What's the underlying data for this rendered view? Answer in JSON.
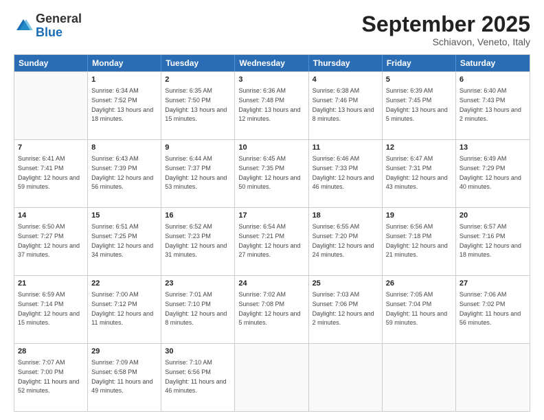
{
  "header": {
    "logo_general": "General",
    "logo_blue": "Blue",
    "month_title": "September 2025",
    "location": "Schiavon, Veneto, Italy"
  },
  "days_of_week": [
    "Sunday",
    "Monday",
    "Tuesday",
    "Wednesday",
    "Thursday",
    "Friday",
    "Saturday"
  ],
  "weeks": [
    [
      {
        "day": "",
        "sunrise": "",
        "sunset": "",
        "daylight": ""
      },
      {
        "day": "1",
        "sunrise": "Sunrise: 6:34 AM",
        "sunset": "Sunset: 7:52 PM",
        "daylight": "Daylight: 13 hours and 18 minutes."
      },
      {
        "day": "2",
        "sunrise": "Sunrise: 6:35 AM",
        "sunset": "Sunset: 7:50 PM",
        "daylight": "Daylight: 13 hours and 15 minutes."
      },
      {
        "day": "3",
        "sunrise": "Sunrise: 6:36 AM",
        "sunset": "Sunset: 7:48 PM",
        "daylight": "Daylight: 13 hours and 12 minutes."
      },
      {
        "day": "4",
        "sunrise": "Sunrise: 6:38 AM",
        "sunset": "Sunset: 7:46 PM",
        "daylight": "Daylight: 13 hours and 8 minutes."
      },
      {
        "day": "5",
        "sunrise": "Sunrise: 6:39 AM",
        "sunset": "Sunset: 7:45 PM",
        "daylight": "Daylight: 13 hours and 5 minutes."
      },
      {
        "day": "6",
        "sunrise": "Sunrise: 6:40 AM",
        "sunset": "Sunset: 7:43 PM",
        "daylight": "Daylight: 13 hours and 2 minutes."
      }
    ],
    [
      {
        "day": "7",
        "sunrise": "Sunrise: 6:41 AM",
        "sunset": "Sunset: 7:41 PM",
        "daylight": "Daylight: 12 hours and 59 minutes."
      },
      {
        "day": "8",
        "sunrise": "Sunrise: 6:43 AM",
        "sunset": "Sunset: 7:39 PM",
        "daylight": "Daylight: 12 hours and 56 minutes."
      },
      {
        "day": "9",
        "sunrise": "Sunrise: 6:44 AM",
        "sunset": "Sunset: 7:37 PM",
        "daylight": "Daylight: 12 hours and 53 minutes."
      },
      {
        "day": "10",
        "sunrise": "Sunrise: 6:45 AM",
        "sunset": "Sunset: 7:35 PM",
        "daylight": "Daylight: 12 hours and 50 minutes."
      },
      {
        "day": "11",
        "sunrise": "Sunrise: 6:46 AM",
        "sunset": "Sunset: 7:33 PM",
        "daylight": "Daylight: 12 hours and 46 minutes."
      },
      {
        "day": "12",
        "sunrise": "Sunrise: 6:47 AM",
        "sunset": "Sunset: 7:31 PM",
        "daylight": "Daylight: 12 hours and 43 minutes."
      },
      {
        "day": "13",
        "sunrise": "Sunrise: 6:49 AM",
        "sunset": "Sunset: 7:29 PM",
        "daylight": "Daylight: 12 hours and 40 minutes."
      }
    ],
    [
      {
        "day": "14",
        "sunrise": "Sunrise: 6:50 AM",
        "sunset": "Sunset: 7:27 PM",
        "daylight": "Daylight: 12 hours and 37 minutes."
      },
      {
        "day": "15",
        "sunrise": "Sunrise: 6:51 AM",
        "sunset": "Sunset: 7:25 PM",
        "daylight": "Daylight: 12 hours and 34 minutes."
      },
      {
        "day": "16",
        "sunrise": "Sunrise: 6:52 AM",
        "sunset": "Sunset: 7:23 PM",
        "daylight": "Daylight: 12 hours and 31 minutes."
      },
      {
        "day": "17",
        "sunrise": "Sunrise: 6:54 AM",
        "sunset": "Sunset: 7:21 PM",
        "daylight": "Daylight: 12 hours and 27 minutes."
      },
      {
        "day": "18",
        "sunrise": "Sunrise: 6:55 AM",
        "sunset": "Sunset: 7:20 PM",
        "daylight": "Daylight: 12 hours and 24 minutes."
      },
      {
        "day": "19",
        "sunrise": "Sunrise: 6:56 AM",
        "sunset": "Sunset: 7:18 PM",
        "daylight": "Daylight: 12 hours and 21 minutes."
      },
      {
        "day": "20",
        "sunrise": "Sunrise: 6:57 AM",
        "sunset": "Sunset: 7:16 PM",
        "daylight": "Daylight: 12 hours and 18 minutes."
      }
    ],
    [
      {
        "day": "21",
        "sunrise": "Sunrise: 6:59 AM",
        "sunset": "Sunset: 7:14 PM",
        "daylight": "Daylight: 12 hours and 15 minutes."
      },
      {
        "day": "22",
        "sunrise": "Sunrise: 7:00 AM",
        "sunset": "Sunset: 7:12 PM",
        "daylight": "Daylight: 12 hours and 11 minutes."
      },
      {
        "day": "23",
        "sunrise": "Sunrise: 7:01 AM",
        "sunset": "Sunset: 7:10 PM",
        "daylight": "Daylight: 12 hours and 8 minutes."
      },
      {
        "day": "24",
        "sunrise": "Sunrise: 7:02 AM",
        "sunset": "Sunset: 7:08 PM",
        "daylight": "Daylight: 12 hours and 5 minutes."
      },
      {
        "day": "25",
        "sunrise": "Sunrise: 7:03 AM",
        "sunset": "Sunset: 7:06 PM",
        "daylight": "Daylight: 12 hours and 2 minutes."
      },
      {
        "day": "26",
        "sunrise": "Sunrise: 7:05 AM",
        "sunset": "Sunset: 7:04 PM",
        "daylight": "Daylight: 11 hours and 59 minutes."
      },
      {
        "day": "27",
        "sunrise": "Sunrise: 7:06 AM",
        "sunset": "Sunset: 7:02 PM",
        "daylight": "Daylight: 11 hours and 56 minutes."
      }
    ],
    [
      {
        "day": "28",
        "sunrise": "Sunrise: 7:07 AM",
        "sunset": "Sunset: 7:00 PM",
        "daylight": "Daylight: 11 hours and 52 minutes."
      },
      {
        "day": "29",
        "sunrise": "Sunrise: 7:09 AM",
        "sunset": "Sunset: 6:58 PM",
        "daylight": "Daylight: 11 hours and 49 minutes."
      },
      {
        "day": "30",
        "sunrise": "Sunrise: 7:10 AM",
        "sunset": "Sunset: 6:56 PM",
        "daylight": "Daylight: 11 hours and 46 minutes."
      },
      {
        "day": "",
        "sunrise": "",
        "sunset": "",
        "daylight": ""
      },
      {
        "day": "",
        "sunrise": "",
        "sunset": "",
        "daylight": ""
      },
      {
        "day": "",
        "sunrise": "",
        "sunset": "",
        "daylight": ""
      },
      {
        "day": "",
        "sunrise": "",
        "sunset": "",
        "daylight": ""
      }
    ]
  ]
}
